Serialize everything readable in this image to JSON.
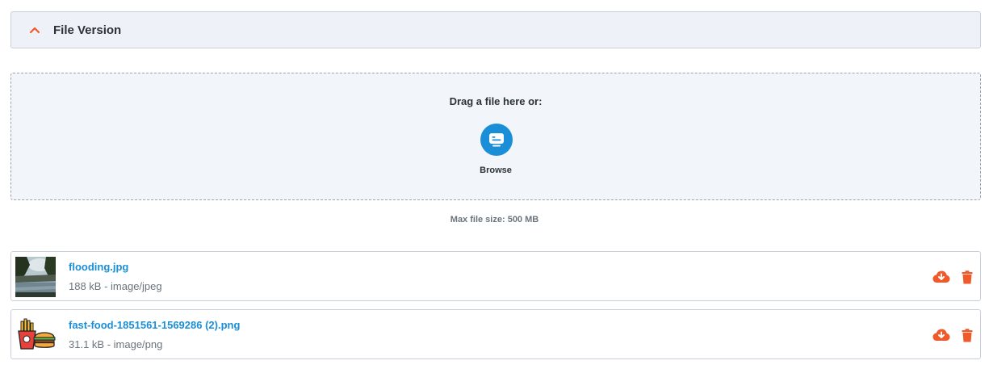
{
  "section": {
    "title": "File Version",
    "expanded": true
  },
  "upload": {
    "drag_text": "Drag a file here or:",
    "browse_label": "Browse",
    "max_size_text": "Max file size: 500 MB"
  },
  "files": [
    {
      "name": "flooding.jpg",
      "meta": "188 kB - image/jpeg",
      "thumb_icon": "photo-thumbnail"
    },
    {
      "name": "fast-food-1851561-1569286 (2).png",
      "meta": "31.1 kB - image/png",
      "thumb_icon": "fast-food-thumbnail"
    }
  ],
  "colors": {
    "accent": "#1a8ed6",
    "action": "#f0592a",
    "header_bg": "#eef1f7",
    "dropzone_bg": "#f2f5f9"
  },
  "icons": {
    "collapse": "chevron-up-icon",
    "browse": "browse-icon",
    "download": "cloud-download-icon",
    "delete": "trash-icon"
  }
}
